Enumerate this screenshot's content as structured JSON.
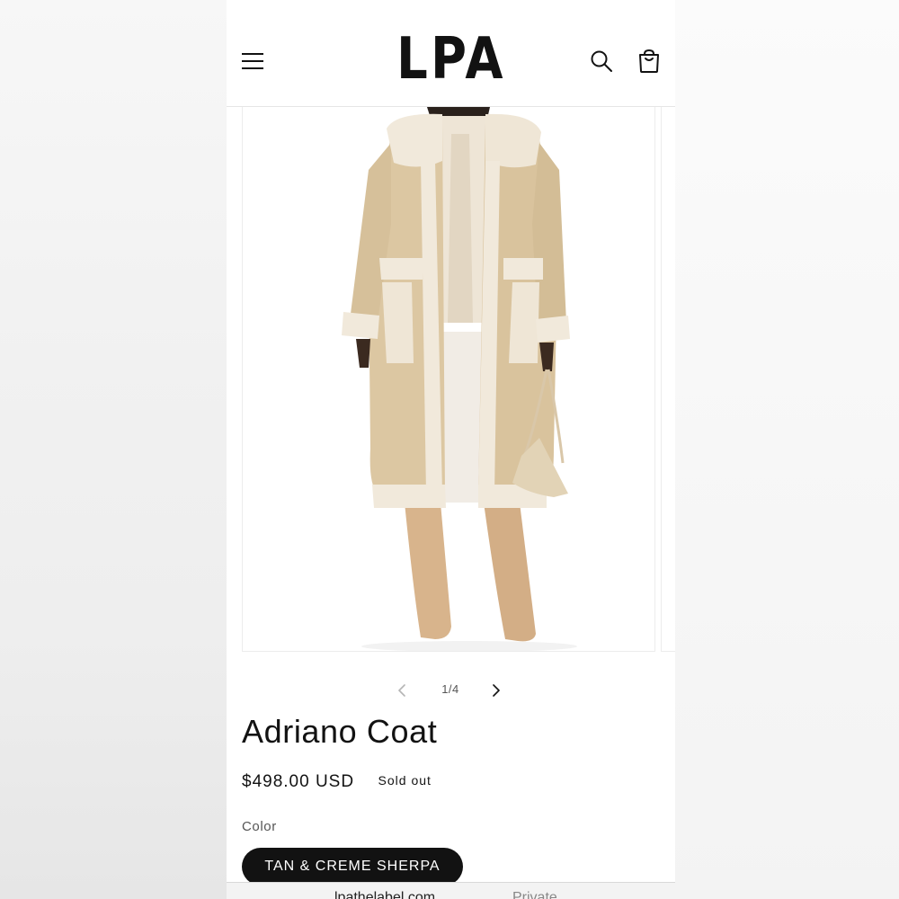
{
  "header": {
    "logo": "LPA",
    "icons": {
      "menu": "hamburger-menu-icon",
      "search": "search-icon",
      "cart": "shopping-bag-icon"
    }
  },
  "gallery": {
    "counter": "1/4",
    "image_alt": "Model wearing tan faux leather coat with creme sherpa trim",
    "icons": {
      "prev": "chevron-left-icon",
      "next": "chevron-right-icon"
    }
  },
  "product": {
    "title": "Adriano Coat",
    "price": "$498.00 USD",
    "badge": "Sold out",
    "color_label": "Color",
    "color_value": "TAN & CREME SHERPA"
  },
  "browser_bar": {
    "url": "lpathelabel.com",
    "mode": "Private"
  },
  "colors": {
    "text": "#121212",
    "swatch_bg": "#121212",
    "swatch_text": "#ffffff",
    "coat": "#dcc7a2",
    "sherpa": "#f1e9db"
  }
}
